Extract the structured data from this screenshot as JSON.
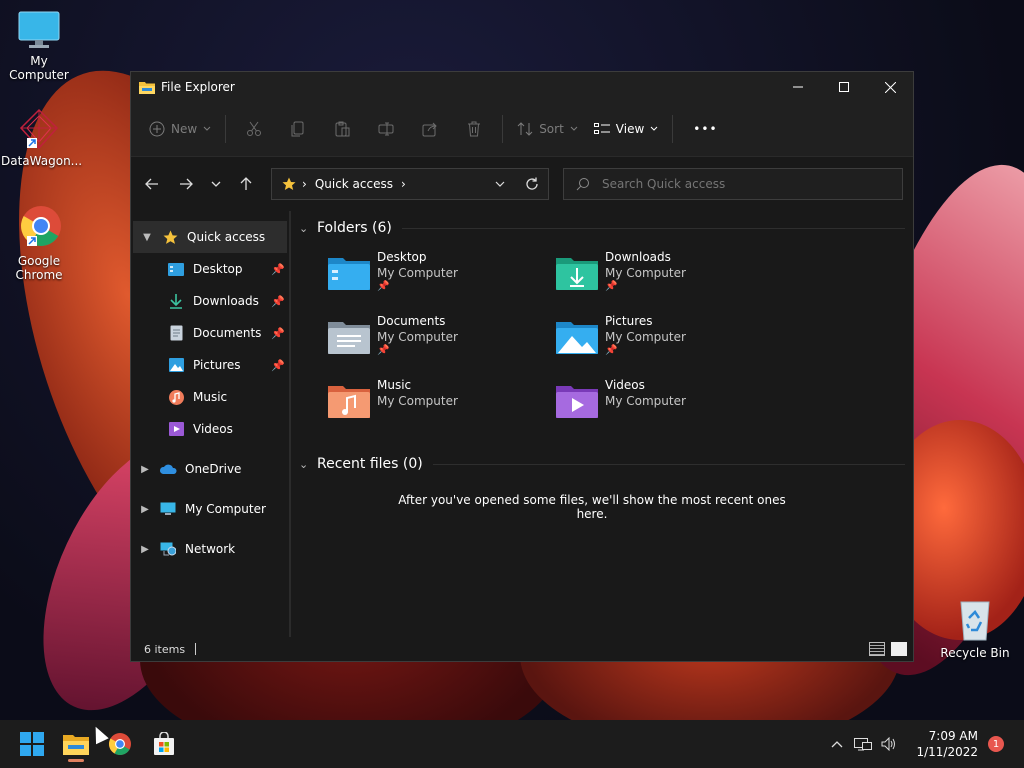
{
  "desktop": {
    "icons": [
      {
        "label": "My Computer"
      },
      {
        "label": "DataWagon..."
      },
      {
        "label": "Google Chrome"
      },
      {
        "label": "Recycle Bin"
      }
    ]
  },
  "window": {
    "title": "File Explorer",
    "toolbar": {
      "new_label": "New",
      "sort_label": "Sort",
      "view_label": "View",
      "more_label": "•••"
    },
    "address": {
      "path_label": "Quick access",
      "separator": "›"
    },
    "search": {
      "placeholder": "Search Quick access"
    },
    "sidebar": {
      "items": [
        {
          "label": "Quick access"
        },
        {
          "label": "Desktop"
        },
        {
          "label": "Downloads"
        },
        {
          "label": "Documents"
        },
        {
          "label": "Pictures"
        },
        {
          "label": "Music"
        },
        {
          "label": "Videos"
        },
        {
          "label": "OneDrive"
        },
        {
          "label": "My Computer"
        },
        {
          "label": "Network"
        }
      ]
    },
    "folders_section": {
      "heading": "Folders (6)",
      "items": [
        {
          "name": "Desktop",
          "location": "My Computer",
          "pinned": true
        },
        {
          "name": "Downloads",
          "location": "My Computer",
          "pinned": true
        },
        {
          "name": "Documents",
          "location": "My Computer",
          "pinned": true
        },
        {
          "name": "Pictures",
          "location": "My Computer",
          "pinned": true
        },
        {
          "name": "Music",
          "location": "My Computer",
          "pinned": false
        },
        {
          "name": "Videos",
          "location": "My Computer",
          "pinned": false
        }
      ]
    },
    "recent_section": {
      "heading": "Recent files (0)",
      "empty_message": "After you've opened some files, we'll show the most recent ones here."
    },
    "status": {
      "item_count": "6 items"
    }
  },
  "taskbar": {
    "clock_time": "7:09 AM",
    "clock_date": "1/11/2022",
    "notification_count": "1"
  },
  "colors": {
    "accent_folder": "#f5c23c",
    "window_bg": "#191919",
    "taskbar_bg": "#1c1c1c",
    "notification": "#e8574f"
  }
}
